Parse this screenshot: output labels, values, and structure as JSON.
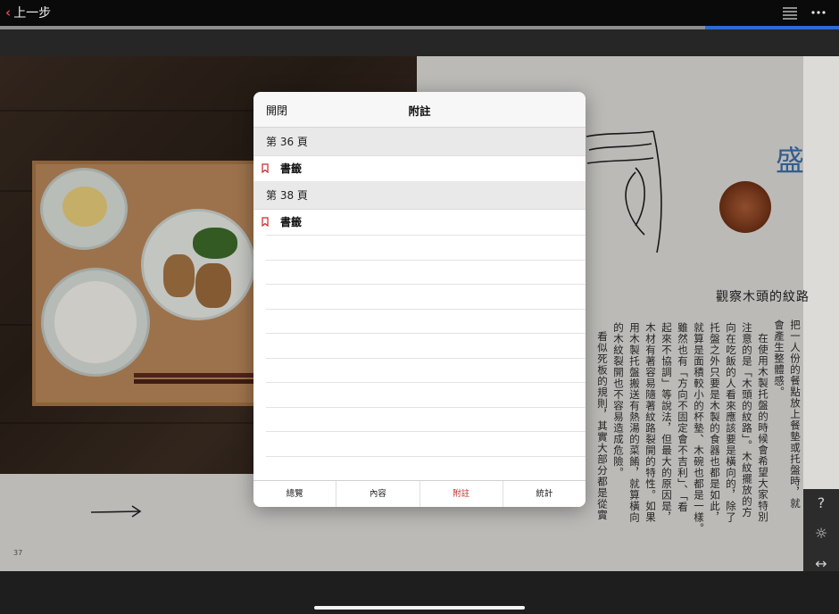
{
  "top_bar": {
    "back_label": "上一步",
    "list_icon": "list-icon",
    "more_icon": "more-icon"
  },
  "reading_progress": 0.16,
  "book": {
    "page_number": "37",
    "heading": "觀察木頭的紋路",
    "seal_char": "盛",
    "columns": [
      "把一人份的餐點放上餐墊或托盤時，就",
      "會產生整體感。",
      "在使用木製托盤的時候會希望大家特別",
      "注意的是「木頭的紋路」。木紋擺放的方",
      "向在吃飯的人看來應該要是橫向的，除了",
      "托盤之外只要是木製的食器也都是如此，",
      "就算是面積較小的杯墊、木碗也都是一樣。",
      "雖然也有「方向不固定會不吉利」、「看",
      "起來不協調」等說法，但最大的原因是，",
      "木材有著容易隨著紋路裂開的特性。如果",
      "用木製托盤搬送有熱湯的菜餚，就算橫向",
      "的木紋裂開也不容易造成危險。",
      "看似死板的規則，其實大部分都是從實"
    ]
  },
  "popover": {
    "close_label": "開閉",
    "title": "附註",
    "sections": [
      {
        "label": "第 36 頁",
        "items": [
          {
            "label": "書籤",
            "icon": "bookmark-icon"
          }
        ]
      },
      {
        "label": "第 38 頁",
        "items": [
          {
            "label": "書籤",
            "icon": "bookmark-icon"
          }
        ]
      }
    ],
    "tabs": [
      {
        "label": "總覽",
        "active": false
      },
      {
        "label": "內容",
        "active": false
      },
      {
        "label": "附註",
        "active": true
      },
      {
        "label": "統計",
        "active": false
      }
    ]
  },
  "side_tools": [
    {
      "icon": "help-icon",
      "glyph": "?"
    },
    {
      "icon": "brightness-icon",
      "glyph": "☼"
    },
    {
      "icon": "page-width-icon",
      "glyph": "↔"
    },
    {
      "icon": "record-icon",
      "glyph": "◉"
    }
  ],
  "colors": {
    "accent_red": "#c9262b",
    "progress_blue": "#2e6ad6",
    "seal_blue": "#3b6ea8"
  }
}
